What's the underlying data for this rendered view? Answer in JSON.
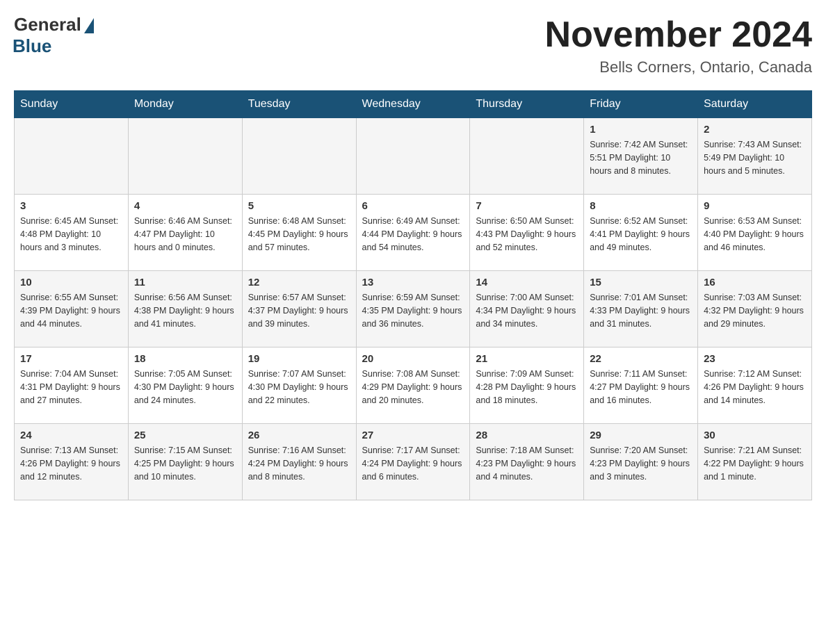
{
  "logo": {
    "general": "General",
    "blue": "Blue"
  },
  "title": "November 2024",
  "location": "Bells Corners, Ontario, Canada",
  "days_of_week": [
    "Sunday",
    "Monday",
    "Tuesday",
    "Wednesday",
    "Thursday",
    "Friday",
    "Saturday"
  ],
  "weeks": [
    [
      {
        "day": "",
        "info": ""
      },
      {
        "day": "",
        "info": ""
      },
      {
        "day": "",
        "info": ""
      },
      {
        "day": "",
        "info": ""
      },
      {
        "day": "",
        "info": ""
      },
      {
        "day": "1",
        "info": "Sunrise: 7:42 AM\nSunset: 5:51 PM\nDaylight: 10 hours and 8 minutes."
      },
      {
        "day": "2",
        "info": "Sunrise: 7:43 AM\nSunset: 5:49 PM\nDaylight: 10 hours and 5 minutes."
      }
    ],
    [
      {
        "day": "3",
        "info": "Sunrise: 6:45 AM\nSunset: 4:48 PM\nDaylight: 10 hours and 3 minutes."
      },
      {
        "day": "4",
        "info": "Sunrise: 6:46 AM\nSunset: 4:47 PM\nDaylight: 10 hours and 0 minutes."
      },
      {
        "day": "5",
        "info": "Sunrise: 6:48 AM\nSunset: 4:45 PM\nDaylight: 9 hours and 57 minutes."
      },
      {
        "day": "6",
        "info": "Sunrise: 6:49 AM\nSunset: 4:44 PM\nDaylight: 9 hours and 54 minutes."
      },
      {
        "day": "7",
        "info": "Sunrise: 6:50 AM\nSunset: 4:43 PM\nDaylight: 9 hours and 52 minutes."
      },
      {
        "day": "8",
        "info": "Sunrise: 6:52 AM\nSunset: 4:41 PM\nDaylight: 9 hours and 49 minutes."
      },
      {
        "day": "9",
        "info": "Sunrise: 6:53 AM\nSunset: 4:40 PM\nDaylight: 9 hours and 46 minutes."
      }
    ],
    [
      {
        "day": "10",
        "info": "Sunrise: 6:55 AM\nSunset: 4:39 PM\nDaylight: 9 hours and 44 minutes."
      },
      {
        "day": "11",
        "info": "Sunrise: 6:56 AM\nSunset: 4:38 PM\nDaylight: 9 hours and 41 minutes."
      },
      {
        "day": "12",
        "info": "Sunrise: 6:57 AM\nSunset: 4:37 PM\nDaylight: 9 hours and 39 minutes."
      },
      {
        "day": "13",
        "info": "Sunrise: 6:59 AM\nSunset: 4:35 PM\nDaylight: 9 hours and 36 minutes."
      },
      {
        "day": "14",
        "info": "Sunrise: 7:00 AM\nSunset: 4:34 PM\nDaylight: 9 hours and 34 minutes."
      },
      {
        "day": "15",
        "info": "Sunrise: 7:01 AM\nSunset: 4:33 PM\nDaylight: 9 hours and 31 minutes."
      },
      {
        "day": "16",
        "info": "Sunrise: 7:03 AM\nSunset: 4:32 PM\nDaylight: 9 hours and 29 minutes."
      }
    ],
    [
      {
        "day": "17",
        "info": "Sunrise: 7:04 AM\nSunset: 4:31 PM\nDaylight: 9 hours and 27 minutes."
      },
      {
        "day": "18",
        "info": "Sunrise: 7:05 AM\nSunset: 4:30 PM\nDaylight: 9 hours and 24 minutes."
      },
      {
        "day": "19",
        "info": "Sunrise: 7:07 AM\nSunset: 4:30 PM\nDaylight: 9 hours and 22 minutes."
      },
      {
        "day": "20",
        "info": "Sunrise: 7:08 AM\nSunset: 4:29 PM\nDaylight: 9 hours and 20 minutes."
      },
      {
        "day": "21",
        "info": "Sunrise: 7:09 AM\nSunset: 4:28 PM\nDaylight: 9 hours and 18 minutes."
      },
      {
        "day": "22",
        "info": "Sunrise: 7:11 AM\nSunset: 4:27 PM\nDaylight: 9 hours and 16 minutes."
      },
      {
        "day": "23",
        "info": "Sunrise: 7:12 AM\nSunset: 4:26 PM\nDaylight: 9 hours and 14 minutes."
      }
    ],
    [
      {
        "day": "24",
        "info": "Sunrise: 7:13 AM\nSunset: 4:26 PM\nDaylight: 9 hours and 12 minutes."
      },
      {
        "day": "25",
        "info": "Sunrise: 7:15 AM\nSunset: 4:25 PM\nDaylight: 9 hours and 10 minutes."
      },
      {
        "day": "26",
        "info": "Sunrise: 7:16 AM\nSunset: 4:24 PM\nDaylight: 9 hours and 8 minutes."
      },
      {
        "day": "27",
        "info": "Sunrise: 7:17 AM\nSunset: 4:24 PM\nDaylight: 9 hours and 6 minutes."
      },
      {
        "day": "28",
        "info": "Sunrise: 7:18 AM\nSunset: 4:23 PM\nDaylight: 9 hours and 4 minutes."
      },
      {
        "day": "29",
        "info": "Sunrise: 7:20 AM\nSunset: 4:23 PM\nDaylight: 9 hours and 3 minutes."
      },
      {
        "day": "30",
        "info": "Sunrise: 7:21 AM\nSunset: 4:22 PM\nDaylight: 9 hours and 1 minute."
      }
    ]
  ]
}
